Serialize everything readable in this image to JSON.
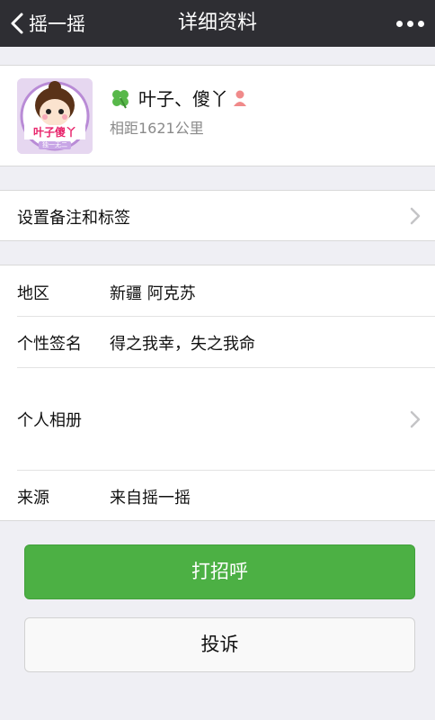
{
  "navbar": {
    "back_label": "摇一摇",
    "title": "详细资料"
  },
  "profile": {
    "name": "叶子、傻丫",
    "distance": "相距1621公里",
    "avatar_text": "叶子傻丫",
    "avatar_subtext": "独一无二",
    "name_icon": "clover-icon",
    "gender_icon": "female-icon"
  },
  "remarks_row": {
    "label": "设置备注和标签"
  },
  "details": {
    "region_label": "地区",
    "region_value": "新疆  阿克苏",
    "signature_label": "个性签名",
    "signature_value": "得之我幸，失之我命",
    "album_label": "个人相册",
    "source_label": "来源",
    "source_value": "来自摇一摇"
  },
  "actions": {
    "greet_label": "打招呼",
    "report_label": "投诉"
  },
  "colors": {
    "navbar": "#2e2e33",
    "primary_button": "#4cb044",
    "background": "#efeff4"
  }
}
